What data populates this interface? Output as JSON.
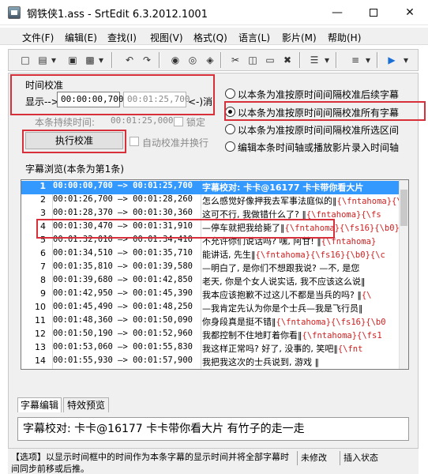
{
  "window": {
    "title": "钢铁侠1.ass - SrtEdit 6.3.2012.1001"
  },
  "menu": [
    "文件(F)",
    "编辑(E)",
    "查找(I)",
    "视图(V)",
    "格式(Q)",
    "语言(L)",
    "影片(M)",
    "帮助(H)"
  ],
  "time_calibration": {
    "group_title": "时间校准",
    "display_label": "显示-->",
    "start_time": "00:00:00,700",
    "end_time": "00:01:25,700",
    "end_suffix": "<-)消隐",
    "duration_label": "本条持续时间:",
    "duration_value": "00:01:25,000",
    "lock_label": "锁定",
    "run_button": "执行校准",
    "auto_label": "自动校准并换行"
  },
  "radio_options": [
    {
      "label": "以本条为准按原时间间隔校准后续字幕",
      "checked": false
    },
    {
      "label": "以本条为准按原时间间隔校准所有字幕",
      "checked": true
    },
    {
      "label": "以本条为准按原时间间隔校准所选区间",
      "checked": false
    },
    {
      "label": "编辑本条时间轴或播放影片录入时间轴",
      "checked": false
    }
  ],
  "browse_title": "字幕浏览(本条为第1条)",
  "subtitles": [
    {
      "index": "1",
      "time": "00:00:00,700 —> 00:01:25,700",
      "text": "字幕校对: 卡卡@16177 卡卡带你看大片",
      "tag": "",
      "selected": true
    },
    {
      "index": "2",
      "time": "00:01:26,700 —> 00:01:28,260",
      "text": "怎么感觉好像押我去军事法庭似的‖",
      "tag": "{\\fntahoma}{\\f",
      "selected": false
    },
    {
      "index": "3",
      "time": "00:01:28,370 —> 00:01:30,360",
      "text": "这可不行, 我做错什么了? ‖",
      "tag": "{\\fntahoma}{\\fs",
      "selected": false
    },
    {
      "index": "4",
      "time": "00:01:30,470 —> 00:01:31,910",
      "text": "—停车就把我给毙了‖",
      "tag": "{\\fntahoma}{\\fs16}{\\b0}{",
      "selected": false
    },
    {
      "index": "5",
      "time": "00:01:32,010 —> 00:01:34,410",
      "text": "不允许你们说话吗? 嘿, 阿甘! ‖",
      "tag": "{\\fntahoma}",
      "selected": false
    },
    {
      "index": "6",
      "time": "00:01:34,510 —> 00:01:35,710",
      "text": "能讲话, 先生‖",
      "tag": "{\\fntahoma}{\\fs16}{\\b0}{\\c",
      "selected": false
    },
    {
      "index": "7",
      "time": "00:01:35,810 —> 00:01:39,580",
      "text": "—明白了, 是你们不想跟我说? —不, 是您",
      "tag": "",
      "selected": false
    },
    {
      "index": "8",
      "time": "00:01:39,680 —> 00:01:42,850",
      "text": "老天, 你是个女人说实话, 我不应该这么说‖",
      "tag": "",
      "selected": false
    },
    {
      "index": "9",
      "time": "00:01:42,950 —> 00:01:45,390",
      "text": "我本应该抱歉不过这儿不都是当兵的吗? ‖",
      "tag": "{\\",
      "selected": false
    },
    {
      "index": "10",
      "time": "00:01:45,490 —> 00:01:48,250",
      "text": "—我肯定先认为你是个士兵—我是飞行员‖",
      "tag": "",
      "selected": false
    },
    {
      "index": "11",
      "time": "00:01:48,360 —> 00:01:50,090",
      "text": "你身段真是挺不错‖",
      "tag": "{\\fntahoma}{\\fs16}{\\b0",
      "selected": false
    },
    {
      "index": "12",
      "time": "00:01:50,190 —> 00:01:52,960",
      "text": "我都控制不住地盯着你看‖",
      "tag": "{\\fntahoma}{\\fs1",
      "selected": false
    },
    {
      "index": "13",
      "time": "00:01:53,060 —> 00:01:55,830",
      "text": "我这样正常吗? 好了, 没事的, 笑吧‖",
      "tag": "{\\fnt",
      "selected": false
    },
    {
      "index": "14",
      "time": "00:01:55,930 —> 00:01:57,900",
      "text": "我把我这次的士兵说到, 游戏 ‖",
      "tag": "",
      "selected": false
    }
  ],
  "tabs": [
    "字幕编辑",
    "特效预览"
  ],
  "editor_text": "字幕校对: 卡卡@16177 卡卡带你看大片 有竹子的走一走",
  "status": {
    "message": "【选项】以显示时间框中的时间作为本条字幕的显示时间并将全部字幕时间同步前移或后推。",
    "modified": "未修改",
    "mode": "插入状态"
  },
  "colors": {
    "highlight_box": "#d8303a",
    "selected_row": "#3399ff",
    "tag_text": "#d02020"
  }
}
